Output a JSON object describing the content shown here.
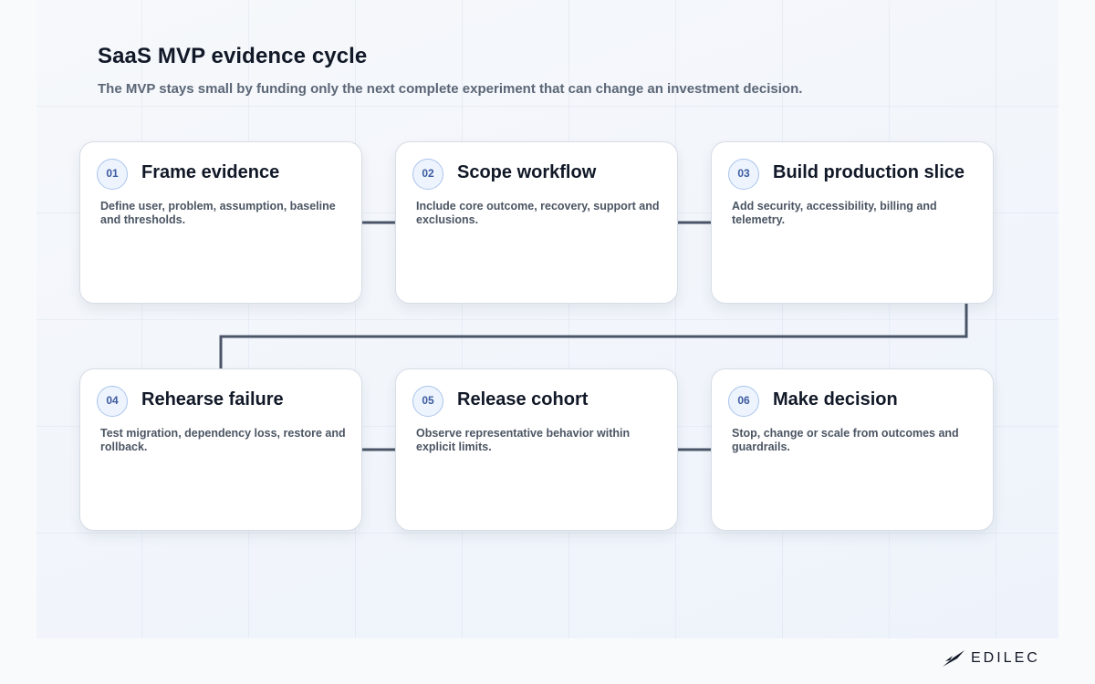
{
  "header": {
    "title": "SaaS MVP evidence cycle",
    "subtitle": "The MVP stays small by funding only the next complete experiment that can change an investment decision."
  },
  "steps": [
    {
      "number": "01",
      "title": "Frame evidence",
      "text": "Define user, problem, assumption, baseline and thresholds."
    },
    {
      "number": "02",
      "title": "Scope workflow",
      "text": "Include core outcome, recovery, support and exclusions."
    },
    {
      "number": "03",
      "title": "Build production slice",
      "text": "Add security, accessibility, billing and telemetry."
    },
    {
      "number": "04",
      "title": "Rehearse failure",
      "text": "Test migration, dependency loss, restore and rollback."
    },
    {
      "number": "05",
      "title": "Release cohort",
      "text": "Observe representative behavior within explicit limits."
    },
    {
      "number": "06",
      "title": "Make decision",
      "text": "Stop, change or scale from outcomes and guardrails."
    }
  ],
  "brand": {
    "name": "EDILEC"
  },
  "colors": {
    "connector": "#4a5568",
    "badge_text": "#3b5aa0",
    "badge_border": "#a9c4ee"
  }
}
